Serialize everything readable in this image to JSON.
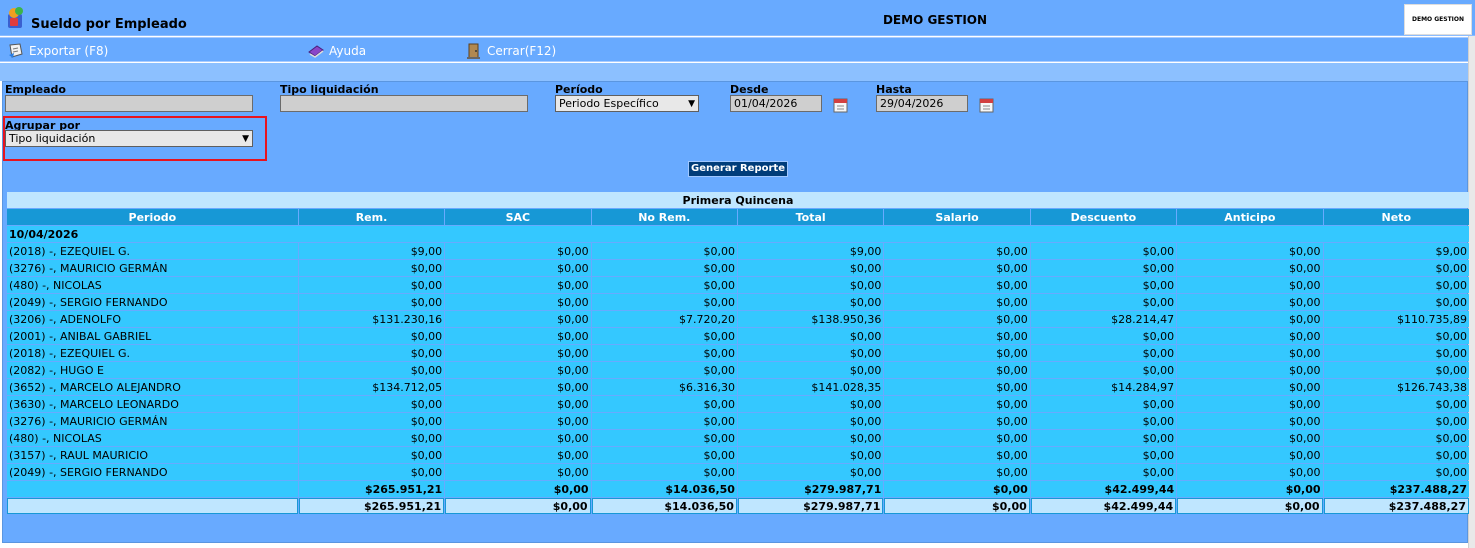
{
  "header": {
    "title": "Sueldo por Empleado",
    "company": "DEMO GESTION",
    "company_logo_text": "DEMO GESTION"
  },
  "toolbar": {
    "export_label": "Exportar (F8)",
    "help_label": "Ayuda",
    "close_label": "Cerrar(F12)"
  },
  "filters": {
    "empleado_label": "Empleado",
    "empleado_value": "",
    "tipo_label": "Tipo liquidación",
    "tipo_value": "",
    "periodo_label": "Período",
    "periodo_value": "Periodo Específico",
    "desde_label": "Desde",
    "desde_value": "01/04/2026",
    "hasta_label": "Hasta",
    "hasta_value": "29/04/2026",
    "agrupar_label": "Agrupar por",
    "agrupar_value": "Tipo liquidación",
    "generate_label": "Generar Reporte"
  },
  "report": {
    "group_title": "Primera Quincena",
    "columns": [
      "Periodo",
      "Rem.",
      "SAC",
      "No Rem.",
      "Total",
      "Salario",
      "Descuento",
      "Anticipo",
      "Neto"
    ],
    "date_group": "10/04/2026",
    "rows": [
      [
        "(2018) -, EZEQUIEL G.",
        "$9,00",
        "$0,00",
        "$0,00",
        "$9,00",
        "$0,00",
        "$0,00",
        "$0,00",
        "$9,00"
      ],
      [
        "(3276) -, MAURICIO GERMÁN",
        "$0,00",
        "$0,00",
        "$0,00",
        "$0,00",
        "$0,00",
        "$0,00",
        "$0,00",
        "$0,00"
      ],
      [
        "(480) -, NICOLAS",
        "$0,00",
        "$0,00",
        "$0,00",
        "$0,00",
        "$0,00",
        "$0,00",
        "$0,00",
        "$0,00"
      ],
      [
        "(2049) -, SERGIO FERNANDO",
        "$0,00",
        "$0,00",
        "$0,00",
        "$0,00",
        "$0,00",
        "$0,00",
        "$0,00",
        "$0,00"
      ],
      [
        "(3206) -, ADENOLFO",
        "$131.230,16",
        "$0,00",
        "$7.720,20",
        "$138.950,36",
        "$0,00",
        "$28.214,47",
        "$0,00",
        "$110.735,89"
      ],
      [
        "(2001) -, ANIBAL GABRIEL",
        "$0,00",
        "$0,00",
        "$0,00",
        "$0,00",
        "$0,00",
        "$0,00",
        "$0,00",
        "$0,00"
      ],
      [
        "(2018) -, EZEQUIEL G.",
        "$0,00",
        "$0,00",
        "$0,00",
        "$0,00",
        "$0,00",
        "$0,00",
        "$0,00",
        "$0,00"
      ],
      [
        "(2082) -, HUGO E",
        "$0,00",
        "$0,00",
        "$0,00",
        "$0,00",
        "$0,00",
        "$0,00",
        "$0,00",
        "$0,00"
      ],
      [
        "(3652) -, MARCELO ALEJANDRO",
        "$134.712,05",
        "$0,00",
        "$6.316,30",
        "$141.028,35",
        "$0,00",
        "$14.284,97",
        "$0,00",
        "$126.743,38"
      ],
      [
        "(3630) -, MARCELO LEONARDO",
        "$0,00",
        "$0,00",
        "$0,00",
        "$0,00",
        "$0,00",
        "$0,00",
        "$0,00",
        "$0,00"
      ],
      [
        "(3276) -, MAURICIO GERMÁN",
        "$0,00",
        "$0,00",
        "$0,00",
        "$0,00",
        "$0,00",
        "$0,00",
        "$0,00",
        "$0,00"
      ],
      [
        "(480) -, NICOLAS",
        "$0,00",
        "$0,00",
        "$0,00",
        "$0,00",
        "$0,00",
        "$0,00",
        "$0,00",
        "$0,00"
      ],
      [
        "(3157) -, RAUL MAURICIO",
        "$0,00",
        "$0,00",
        "$0,00",
        "$0,00",
        "$0,00",
        "$0,00",
        "$0,00",
        "$0,00"
      ],
      [
        "(2049) -, SERGIO FERNANDO",
        "$0,00",
        "$0,00",
        "$0,00",
        "$0,00",
        "$0,00",
        "$0,00",
        "$0,00",
        "$0,00"
      ]
    ],
    "subtotal": [
      "",
      "$265.951,21",
      "$0,00",
      "$14.036,50",
      "$279.987,71",
      "$0,00",
      "$42.499,44",
      "$0,00",
      "$237.488,27"
    ],
    "grand_total": [
      "",
      "$265.951,21",
      "$0,00",
      "$14.036,50",
      "$279.987,71",
      "$0,00",
      "$42.499,44",
      "$0,00",
      "$237.488,27"
    ]
  },
  "colors": {
    "panel": "#68aaff",
    "header_cell": "#1798d6",
    "row_cell": "#34c8ff",
    "band_cell": "#bfe6ff",
    "highlight": "#e8141e"
  }
}
